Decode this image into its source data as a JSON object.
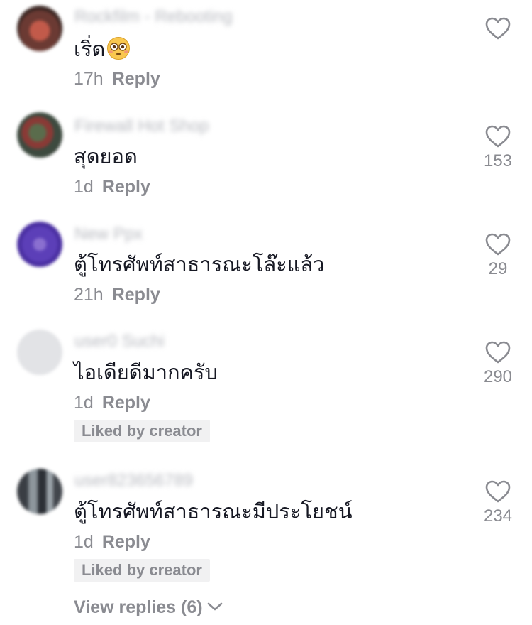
{
  "comments": [
    {
      "username": "Rockfilm - Rebooting",
      "text": "เริ่ด",
      "emoji": "flushed-face-emoji",
      "time": "17h",
      "reply": "Reply",
      "likes": "",
      "liked_by_creator": ""
    },
    {
      "username": "Firewall Hot Shop",
      "text": "สุดยอด",
      "time": "1d",
      "reply": "Reply",
      "likes": "153",
      "liked_by_creator": ""
    },
    {
      "username": "New Ppx",
      "text": "ตู้โทรศัพท์สาธารณะโล๊ะแล้ว",
      "time": "21h",
      "reply": "Reply",
      "likes": "29",
      "liked_by_creator": ""
    },
    {
      "username": "user0 Suchi",
      "text": "ไอเดียดีมากครับ",
      "time": "1d",
      "reply": "Reply",
      "likes": "290",
      "liked_by_creator": "Liked by creator"
    },
    {
      "username": "user823656789",
      "text": "ตู้โทรศัพท์สาธารณะมีประโยชน์",
      "time": "1d",
      "reply": "Reply",
      "likes": "234",
      "liked_by_creator": "Liked by creator"
    }
  ],
  "view_replies": "View replies (6)",
  "icons": {
    "like": "heart-outline-icon",
    "expand": "chevron-down-icon"
  },
  "colors": {
    "text": "#161823",
    "muted": "#8a8b91",
    "badge_bg": "#f1f1f2"
  }
}
